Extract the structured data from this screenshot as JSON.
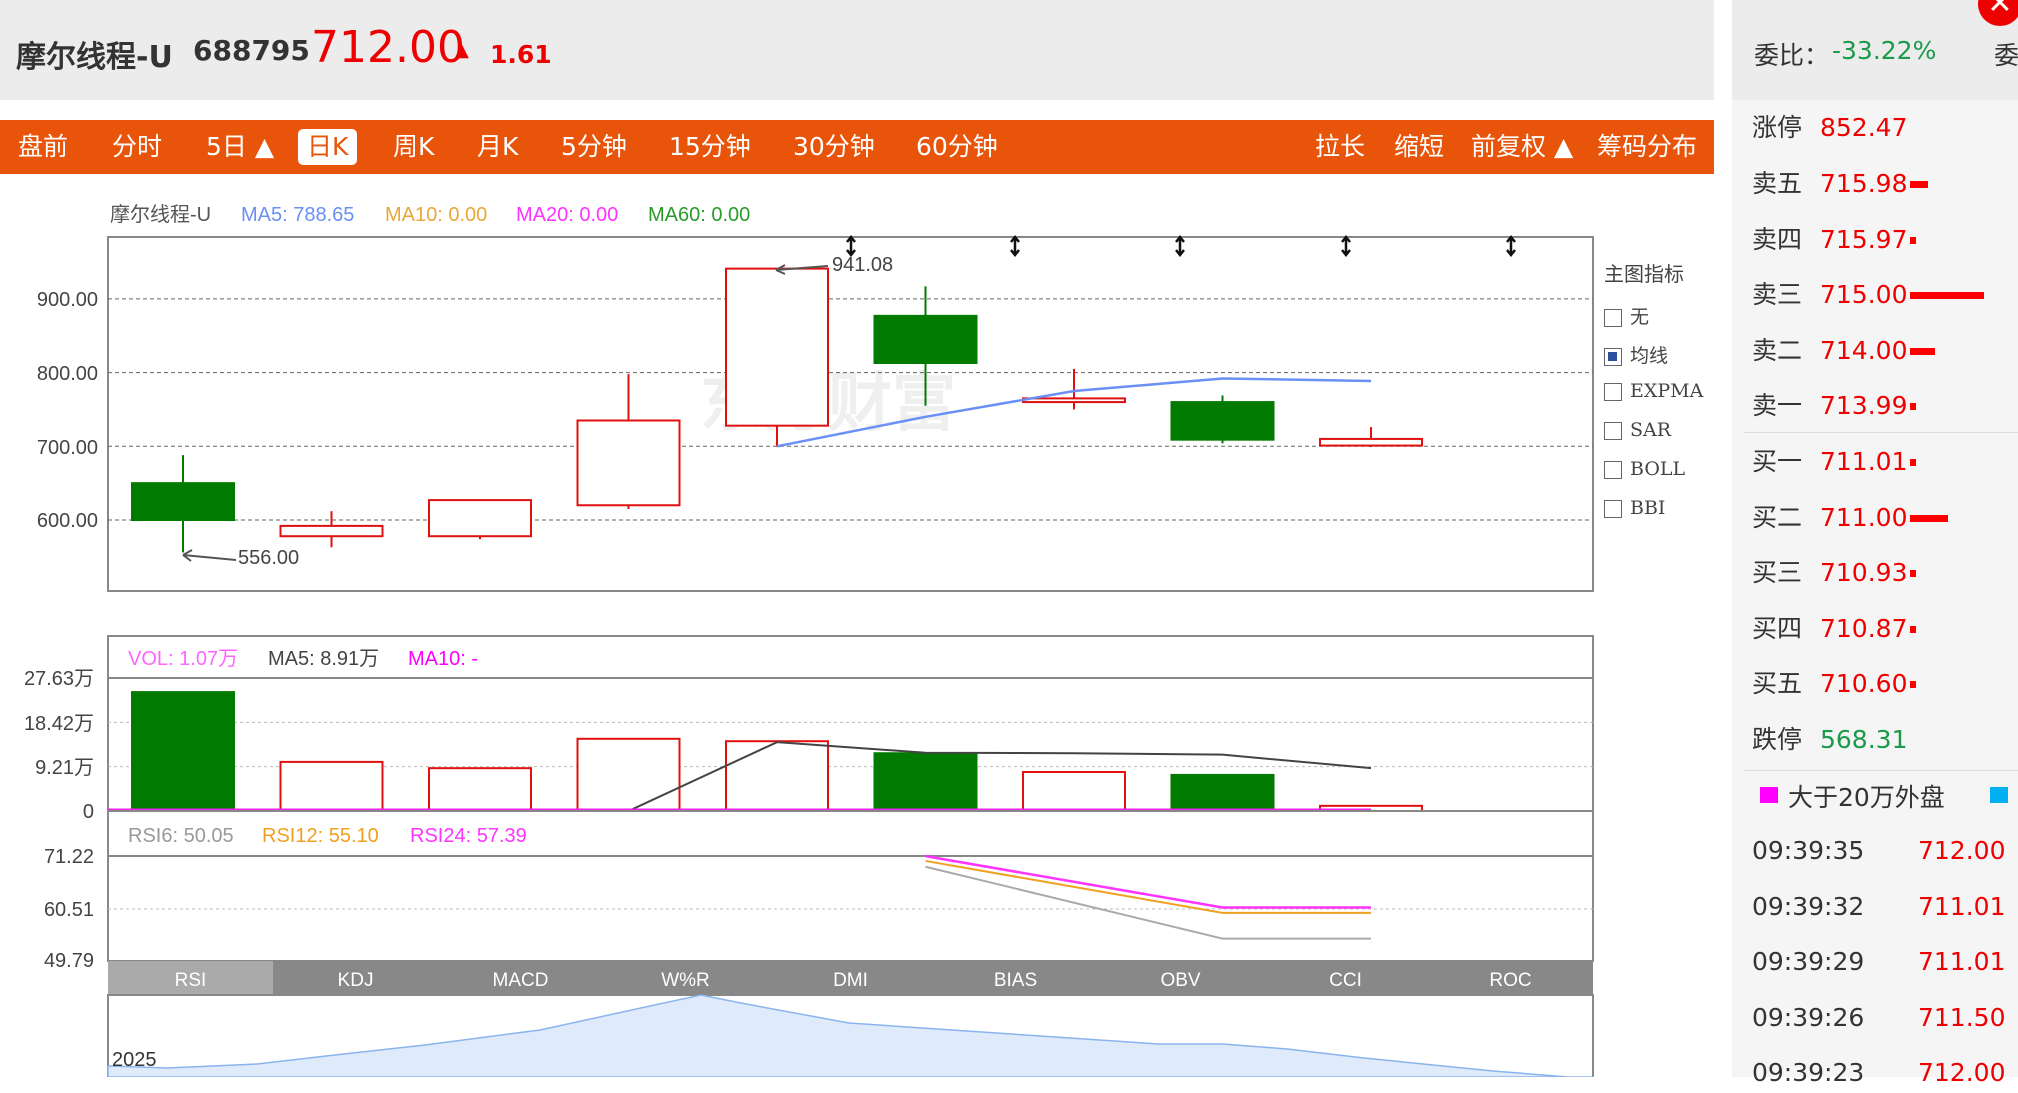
{
  "header": {
    "name": "摩尔线程-U",
    "code": "688795",
    "price": "712.00",
    "arrow": "▲",
    "change": "1.61"
  },
  "toolbar": {
    "left": [
      "盘前",
      "分时",
      "5日 ▲",
      "日K",
      "周K",
      "月K",
      "5分钟",
      "15分钟",
      "30分钟",
      "60分钟"
    ],
    "selected": "日K",
    "right": [
      "拉长",
      "缩短",
      "前复权 ▲",
      "筹码分布"
    ]
  },
  "legend": {
    "name": "摩尔线程-U",
    "ma5": "MA5: 788.65",
    "ma10": "MA10: 0.00",
    "ma20": "MA20: 0.00",
    "ma60": "MA60: 0.00"
  },
  "indicator_panel": {
    "title": "主图指标",
    "items": [
      {
        "label": "无",
        "checked": false
      },
      {
        "label": "均线",
        "checked": true
      },
      {
        "label": "EXPMA",
        "checked": false
      },
      {
        "label": "SAR",
        "checked": false
      },
      {
        "label": "BOLL",
        "checked": false
      },
      {
        "label": "BBI",
        "checked": false
      }
    ]
  },
  "chart_data": {
    "type": "candlestick",
    "price_axis": {
      "ticks": [
        "900.00",
        "800.00",
        "700.00",
        "600.00"
      ],
      "tick_values": [
        900,
        800,
        700,
        600
      ]
    },
    "candles": [
      {
        "o": 650,
        "c": 600,
        "h": 688,
        "l": 556
      },
      {
        "o": 578,
        "c": 592,
        "h": 612,
        "l": 563
      },
      {
        "o": 578,
        "c": 627,
        "h": 627,
        "l": 574
      },
      {
        "o": 620,
        "c": 735,
        "h": 798,
        "l": 615
      },
      {
        "o": 728,
        "c": 941.08,
        "h": 941.08,
        "l": 700
      },
      {
        "o": 877,
        "c": 813,
        "h": 917,
        "l": 755
      },
      {
        "o": 760,
        "c": 765,
        "h": 805,
        "l": 750
      },
      {
        "o": 760,
        "c": 709,
        "h": 769,
        "l": 704
      },
      {
        "o": 701,
        "c": 710,
        "h": 726,
        "l": 699
      }
    ],
    "ma5": [
      null,
      null,
      null,
      null,
      700,
      740,
      775,
      792,
      788.65
    ],
    "annotations": {
      "high": "941.08",
      "low": "556.00"
    },
    "watermark": "东方财富",
    "volume": {
      "legend": {
        "vol": "VOL: 1.07万",
        "ma5": "MA5: 8.91万",
        "ma10": "MA10: -"
      },
      "ticks": [
        "27.63万",
        "18.42万",
        "9.21万",
        "0"
      ],
      "max": 27.63,
      "values": [
        24.7,
        10.2,
        8.9,
        15.0,
        14.5,
        12.0,
        8.1,
        7.5,
        1.07
      ],
      "ma5": [
        null,
        null,
        null,
        0,
        14.3,
        12.1,
        12.0,
        11.7,
        8.91
      ]
    },
    "rsi": {
      "legend": {
        "rsi6": "RSI6: 50.05",
        "rsi12": "RSI12: 55.10",
        "rsi24": "RSI24: 57.39"
      },
      "ticks": [
        "71.22",
        "60.51",
        "49.79"
      ],
      "range": [
        49.79,
        71.22
      ],
      "rsi6": [
        null,
        null,
        null,
        null,
        null,
        69.0,
        null,
        54.2,
        54.2
      ],
      "rsi12": [
        null,
        null,
        null,
        null,
        null,
        70.2,
        null,
        59.5,
        59.5
      ],
      "rsi24": [
        null,
        null,
        null,
        null,
        null,
        71.2,
        null,
        60.6,
        60.6
      ]
    },
    "overview_label": "2025"
  },
  "indicator_tabs": [
    "RSI",
    "KDJ",
    "MACD",
    "W%R",
    "DMI",
    "BIAS",
    "OBV",
    "CCI",
    "ROC"
  ],
  "indicator_tab_selected": "RSI",
  "orderbook": {
    "ratio_label": "委比：",
    "ratio_value": "-33.22%",
    "cut_label": "委",
    "limit_up": {
      "label": "涨停",
      "price": "852.47"
    },
    "asks": [
      {
        "label": "卖五",
        "price": "715.98",
        "vol_rel": 0.24
      },
      {
        "label": "卖四",
        "price": "715.97",
        "vol_rel": 0.08
      },
      {
        "label": "卖三",
        "price": "715.00",
        "vol_rel": 1.0
      },
      {
        "label": "卖二",
        "price": "714.00",
        "vol_rel": 0.34
      },
      {
        "label": "卖一",
        "price": "713.99",
        "vol_rel": 0.08
      }
    ],
    "bids": [
      {
        "label": "买一",
        "price": "711.01",
        "vol_rel": 0.08
      },
      {
        "label": "买二",
        "price": "711.00",
        "vol_rel": 0.52
      },
      {
        "label": "买三",
        "price": "710.93",
        "vol_rel": 0.08
      },
      {
        "label": "买四",
        "price": "710.87",
        "vol_rel": 0.08
      },
      {
        "label": "买五",
        "price": "710.60",
        "vol_rel": 0.08
      }
    ],
    "limit_down": {
      "label": "跌停",
      "price": "568.31"
    },
    "trade_legend": {
      "label": "大于20万外盘",
      "color": "#ff00ff",
      "second_color": "#00b0f0"
    },
    "trades": [
      {
        "time": "09:39:35",
        "price": "712.00"
      },
      {
        "time": "09:39:32",
        "price": "711.01"
      },
      {
        "time": "09:39:29",
        "price": "711.01"
      },
      {
        "time": "09:39:26",
        "price": "711.50"
      },
      {
        "time": "09:39:23",
        "price": "712.00"
      }
    ]
  },
  "colors": {
    "up": "#e01010",
    "down": "#007a00",
    "accent": "#e8540a",
    "ma5": "#6a8ff5",
    "ma10": "#e8a838",
    "ma20": "#ff33ff",
    "ma60": "#2a9a2a",
    "vol_ma5": "#444444"
  }
}
